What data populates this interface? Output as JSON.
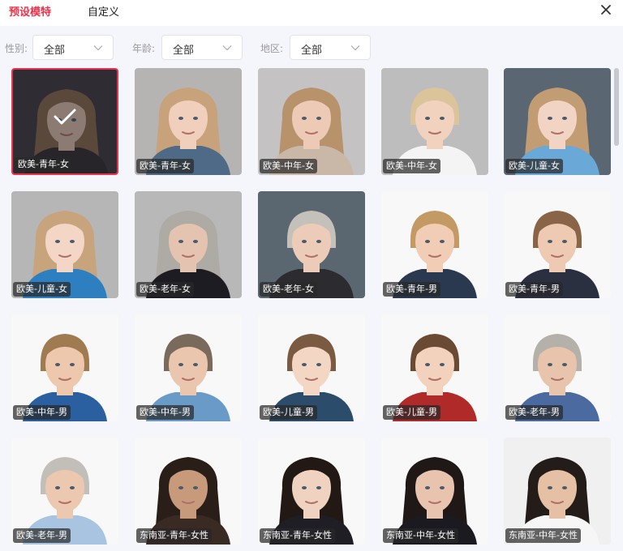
{
  "header": {
    "tabs": [
      {
        "label": "预设模特",
        "active": true
      },
      {
        "label": "自定义",
        "active": false
      }
    ]
  },
  "filters": [
    {
      "label": "性别:",
      "value": "全部"
    },
    {
      "label": "年龄:",
      "value": "全部"
    },
    {
      "label": "地区:",
      "value": "全部"
    }
  ],
  "models": [
    {
      "label": "欧美-青年-女",
      "selected": true,
      "bg": "#3c3a3c",
      "hair": "#8a6a4c",
      "skin": "#e6c6b0",
      "shirt": "#2e2a2c",
      "long": true
    },
    {
      "label": "欧美-青年-女",
      "selected": false,
      "bg": "#b6b4b2",
      "hair": "#c7a27a",
      "skin": "#f0d0bc",
      "shirt": "#4e6a86",
      "long": true
    },
    {
      "label": "欧美-中年-女",
      "selected": false,
      "bg": "#c4c2c2",
      "hair": "#b7926a",
      "skin": "#eccab6",
      "shirt": "#c9b8a8",
      "long": true
    },
    {
      "label": "欧美-中年-女",
      "selected": false,
      "bg": "#bdbdbd",
      "hair": "#dcc49a",
      "skin": "#f1d2bf",
      "shirt": "#f4f4f4",
      "long": false
    },
    {
      "label": "欧美-儿童-女",
      "selected": false,
      "bg": "#5a6672",
      "hair": "#c29c72",
      "skin": "#f2d4c4",
      "shirt": "#6aa8d8",
      "long": true
    },
    {
      "label": "欧美-儿童-女",
      "selected": false,
      "bg": "#b6b6b6",
      "hair": "#c8a47c",
      "skin": "#f3d6c6",
      "shirt": "#2e7fc0",
      "long": true
    },
    {
      "label": "欧美-老年-女",
      "selected": false,
      "bg": "#b8b8b8",
      "hair": "#aeaaa4",
      "skin": "#e4c4b0",
      "shirt": "#1c1c22",
      "long": true
    },
    {
      "label": "欧美-老年-女",
      "selected": false,
      "bg": "#5a6670",
      "hair": "#c4c0ba",
      "skin": "#ecccb8",
      "shirt": "#2c2c30",
      "long": false
    },
    {
      "label": "欧美-青年-男",
      "selected": false,
      "bg": "#f8f8f8",
      "hair": "#c49a64",
      "skin": "#f0cdb4",
      "shirt": "#2a3850",
      "long": false
    },
    {
      "label": "欧美-青年-男",
      "selected": false,
      "bg": "#f8f8f8",
      "hair": "#8a6446",
      "skin": "#eecab2",
      "shirt": "#2a3040",
      "long": false
    },
    {
      "label": "欧美-中年-男",
      "selected": false,
      "bg": "#f8f8f8",
      "hair": "#a07a50",
      "skin": "#eec8ac",
      "shirt": "#2a60a0",
      "long": false
    },
    {
      "label": "欧美-中年-男",
      "selected": false,
      "bg": "#f8f8f8",
      "hair": "#7a6a5c",
      "skin": "#eac6ae",
      "shirt": "#6a9ac8",
      "long": false
    },
    {
      "label": "欧美-儿童-男",
      "selected": false,
      "bg": "#f8f8f8",
      "hair": "#7a5a40",
      "skin": "#f4d6c4",
      "shirt": "#2c4c6c",
      "long": false
    },
    {
      "label": "欧美-儿童-男",
      "selected": false,
      "bg": "#f8f8f8",
      "hair": "#6a4a32",
      "skin": "#f2d2bc",
      "shirt": "#b02a2a",
      "long": false
    },
    {
      "label": "欧美-老年-男",
      "selected": false,
      "bg": "#f8f8f8",
      "hair": "#b4b0aa",
      "skin": "#e8c4ac",
      "shirt": "#4a6aa0",
      "long": false
    },
    {
      "label": "欧美-老年-男",
      "selected": false,
      "bg": "#f8f8f8",
      "hair": "#c2beb8",
      "skin": "#ecc8b0",
      "shirt": "#a8c4e0",
      "long": false
    },
    {
      "label": "东南亚-青年-女性",
      "selected": false,
      "bg": "#f8f8f8",
      "hair": "#2a1e18",
      "skin": "#c89a7c",
      "shirt": "#3a2a24",
      "long": true
    },
    {
      "label": "东南亚-青年-女性",
      "selected": false,
      "bg": "#f8f8f8",
      "hair": "#221814",
      "skin": "#f0d2c0",
      "shirt": "#1e1e24",
      "long": true
    },
    {
      "label": "东南亚-中年-女性",
      "selected": false,
      "bg": "#f8f8f8",
      "hair": "#201816",
      "skin": "#e8c4ae",
      "shirt": "#1a1a20",
      "long": true
    },
    {
      "label": "东南亚-中年-女性",
      "selected": false,
      "bg": "#f0f0f0",
      "hair": "#241c18",
      "skin": "#e6c0a4",
      "shirt": "#f6f6f6",
      "long": true
    }
  ],
  "colors": {
    "accent": "#e8334a",
    "panel_bg": "#f5f5fc"
  }
}
